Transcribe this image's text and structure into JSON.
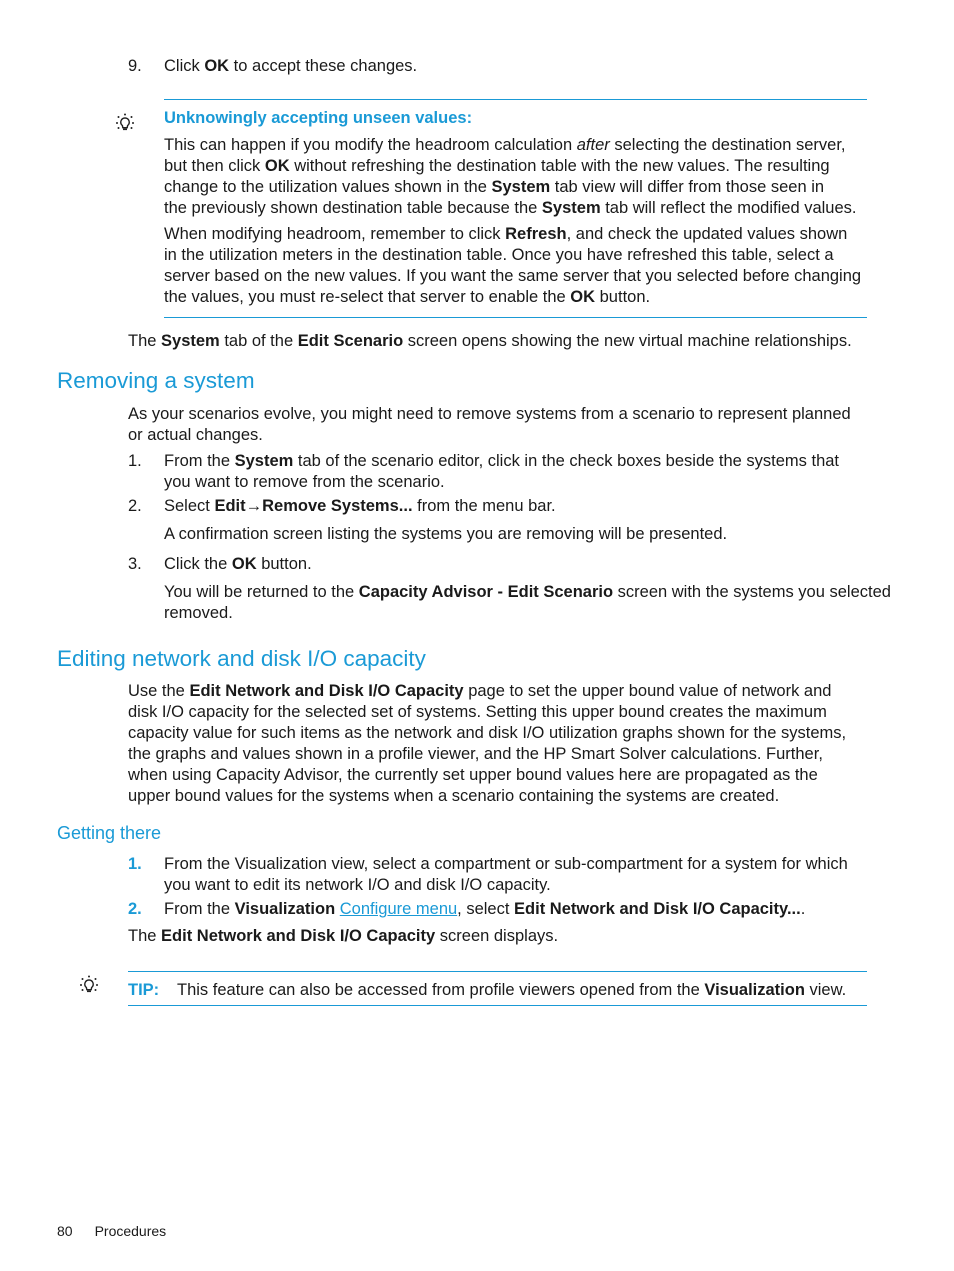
{
  "step9": {
    "num": "9.",
    "pre": "Click ",
    "bold": "OK",
    "post": " to accept these changes."
  },
  "note": {
    "icon": "lightbulb-icon",
    "title": "Unknowingly accepting unseen values:",
    "p1": {
      "l1a": "This can happen if you modify the headroom calculation ",
      "l1i": "after",
      "l1b": " selecting the destination server,",
      "l2a": "but then click ",
      "l2b": "OK",
      "l2c": " without refreshing the destination table with the new values. The resulting",
      "l3a": "change to the utilization values shown in the ",
      "l3b": "System",
      "l3c": " tab view will differ from those seen in",
      "l4a": "the previously shown destination table because the ",
      "l4b": "System",
      "l4c": " tab will reflect the modified values."
    },
    "p2": {
      "l1a": "When modifying headroom, remember to click ",
      "l1b": "Refresh",
      "l1c": ", and check the updated values shown",
      "l2": "in the utilization meters in the destination table. Once you have refreshed this table, select a",
      "l3": "server based on the new values. If you want the same server that you selected before changing",
      "l4a": "the values, you must re-select that server to enable the ",
      "l4b": "OK",
      "l4c": " button."
    }
  },
  "after_note": {
    "a": "The ",
    "b": "System",
    "c": " tab of the ",
    "d": "Edit Scenario",
    "e": " screen opens showing the new virtual machine relationships."
  },
  "section1": {
    "heading": "Removing a system",
    "intro1": "As your scenarios evolve, you might need to remove systems from a scenario to represent planned",
    "intro2": "or actual changes.",
    "s1": {
      "num": "1.",
      "a": "From the ",
      "b": "System",
      "c": " tab of the scenario editor, click in the check boxes beside the systems that",
      "l2": "you want to remove from the scenario."
    },
    "s2": {
      "num": "2.",
      "a": "Select ",
      "b": "Edit",
      "arrow": "→",
      "c": "Remove Systems...",
      "d": " from the menu bar.",
      "sub": "A confirmation screen listing the systems you are removing will be presented."
    },
    "s3": {
      "num": "3.",
      "a": "Click the ",
      "b": "OK",
      "c": " button.",
      "sub_a": "You will be returned to the ",
      "sub_b": "Capacity Advisor - Edit Scenario",
      "sub_c": " screen with the systems you selected",
      "sub_l2": "removed."
    }
  },
  "section2": {
    "heading": "Editing network and disk I/O capacity",
    "p_a": "Use the ",
    "p_b": "Edit Network and Disk I/O Capacity",
    "p_c": " page to set the upper bound value of network and",
    "l2": "disk I/O capacity for the selected set of systems. Setting this upper bound creates the maximum",
    "l3": "capacity value for such items as the network and disk I/O utilization graphs shown for the systems,",
    "l4": "the graphs and values shown in a profile viewer, and the HP Smart Solver calculations. Further,",
    "l5": "when using Capacity Advisor, the currently set upper bound values here are propagated as the",
    "l6": "upper bound values for the systems when a scenario containing the systems are created."
  },
  "section3": {
    "heading": "Getting there",
    "s1": {
      "num": "1.",
      "l1": "From the Visualization view, select a compartment or sub-compartment for a system for which",
      "l2": "you want to edit its network I/O and disk I/O capacity."
    },
    "s2": {
      "num": "2.",
      "a": "From the ",
      "b": "Visualization",
      "link": "Configure menu",
      "c": ", select ",
      "d": "Edit Network and Disk I/O Capacity...",
      "e": "."
    },
    "result_a": "The ",
    "result_b": "Edit Network and Disk I/O Capacity",
    "result_c": " screen displays."
  },
  "tip": {
    "icon": "lightbulb-icon",
    "label": "TIP:",
    "a": "This feature can also be accessed from profile viewers opened from the ",
    "b": "Visualization",
    "c": " view."
  },
  "footer": {
    "page": "80",
    "section": "Procedures"
  }
}
